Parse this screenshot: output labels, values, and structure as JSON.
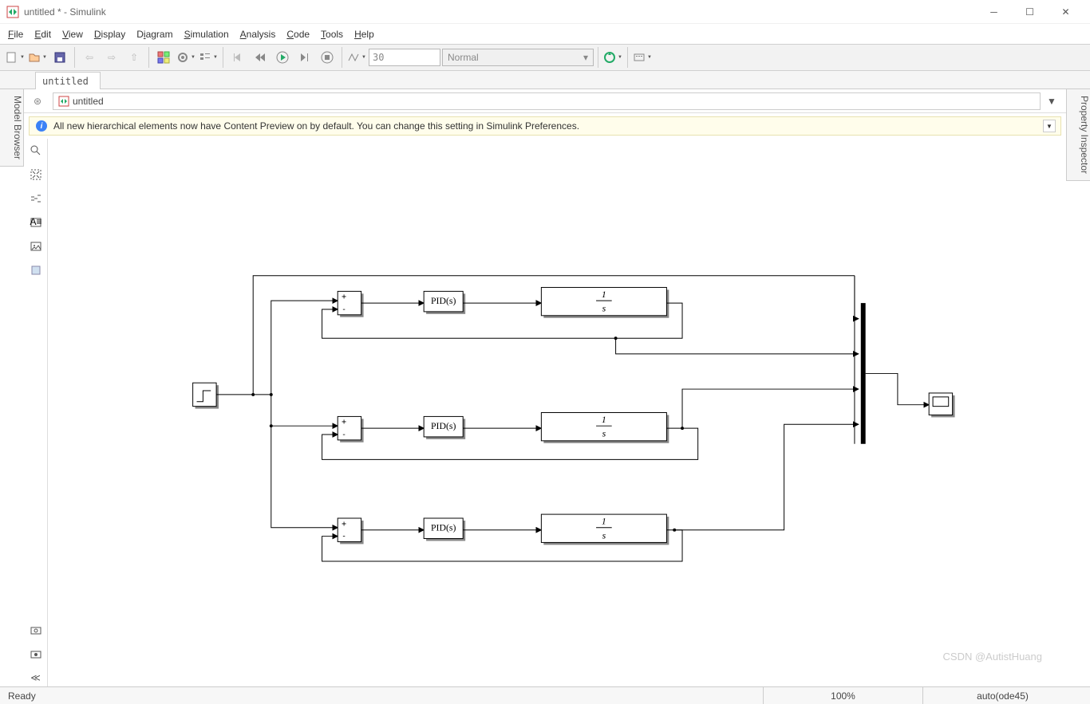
{
  "window": {
    "title": "untitled * - Simulink"
  },
  "menu": {
    "file": "File",
    "edit": "Edit",
    "view": "View",
    "display": "Display",
    "diagram": "Diagram",
    "simulation": "Simulation",
    "analysis": "Analysis",
    "code": "Code",
    "tools": "Tools",
    "help": "Help"
  },
  "toolbar": {
    "stop_time": "30",
    "mode": "Normal"
  },
  "tabs": {
    "active": "untitled"
  },
  "breadcrumb": {
    "model": "untitled"
  },
  "banner": {
    "text": "All new hierarchical elements now have Content Preview on by default. You can change this setting in Simulink Preferences."
  },
  "sidepanels": {
    "left": "Model Browser",
    "right": "Property Inspector"
  },
  "diagram": {
    "source_block": "Step",
    "sum_block": "Sum",
    "pid_block": "PID(s)",
    "tf_num": "1",
    "tf_den": "s",
    "mux_block": "Mux",
    "scope_block": "Scope",
    "branches": 3
  },
  "status": {
    "ready": "Ready",
    "zoom": "100%",
    "solver": "auto(ode45)"
  },
  "watermark": "CSDN @AutistHuang"
}
